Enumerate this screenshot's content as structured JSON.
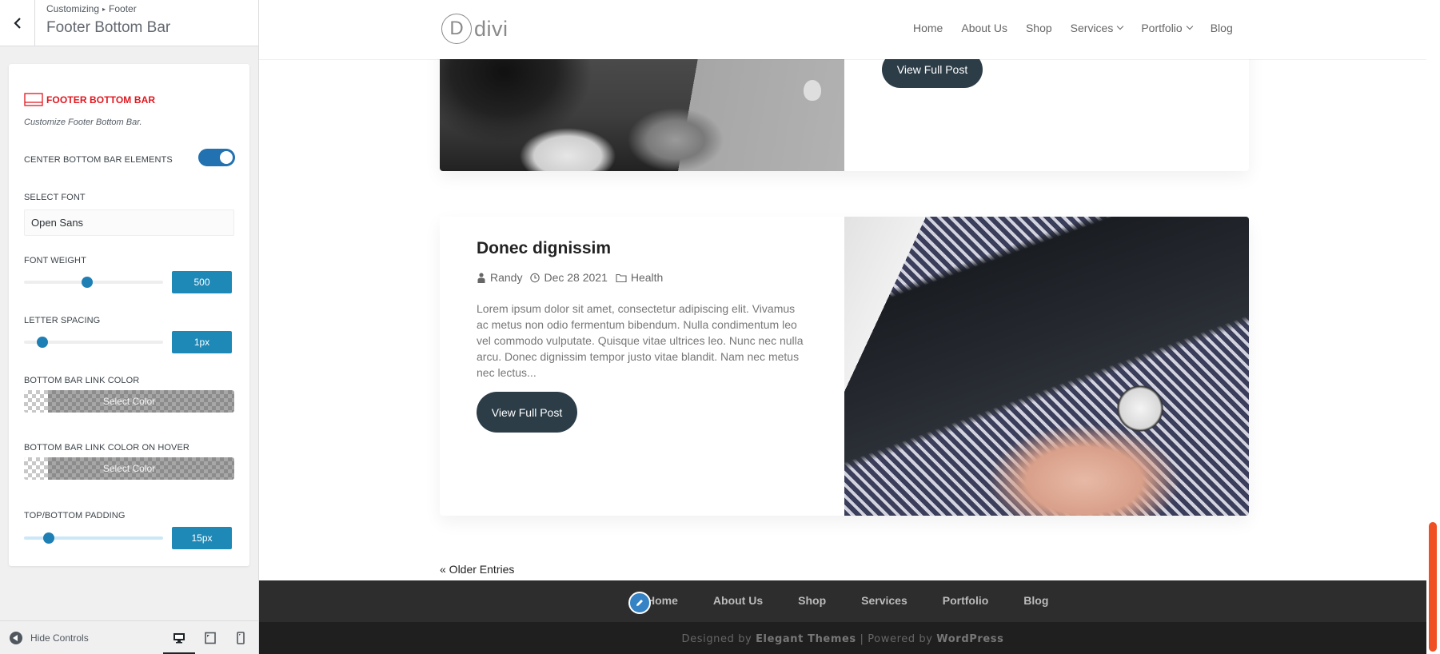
{
  "customizer": {
    "breadcrumb": {
      "root": "Customizing",
      "separator": "▸",
      "parent": "Footer"
    },
    "title": "Footer Bottom Bar",
    "section": {
      "title": "FOOTER BOTTOM BAR",
      "description": "Customize Footer Bottom Bar.",
      "accent_color": "#e0161e"
    },
    "controls": {
      "center_elements": {
        "label": "CENTER BOTTOM BAR ELEMENTS",
        "enabled": true
      },
      "select_font": {
        "label": "SELECT FONT",
        "value": "Open Sans"
      },
      "font_weight": {
        "label": "FONT WEIGHT",
        "value": "500",
        "slider_fraction": 0.45
      },
      "letter_spacing": {
        "label": "LETTER SPACING",
        "value": "1px",
        "slider_fraction": 0.1
      },
      "link_color": {
        "label": "BOTTOM BAR LINK COLOR",
        "button": "Select Color"
      },
      "link_color_hover": {
        "label": "BOTTOM BAR LINK COLOR ON HOVER",
        "button": "Select Color"
      },
      "padding": {
        "label": "TOP/BOTTOM PADDING",
        "value": "15px",
        "slider_fraction": 0.15
      }
    },
    "footer": {
      "hide_controls": "Hide Controls",
      "devices": [
        {
          "name": "desktop",
          "active": true
        },
        {
          "name": "tablet",
          "active": false
        },
        {
          "name": "mobile",
          "active": false
        }
      ]
    }
  },
  "site": {
    "logo_letter": "D",
    "logo_word": "divi",
    "nav": [
      {
        "label": "Home",
        "dropdown": false
      },
      {
        "label": "About Us",
        "dropdown": false
      },
      {
        "label": "Shop",
        "dropdown": false
      },
      {
        "label": "Services",
        "dropdown": true
      },
      {
        "label": "Portfolio",
        "dropdown": true
      },
      {
        "label": "Blog",
        "dropdown": false
      }
    ],
    "posts": [
      {
        "button": "View Full Post"
      },
      {
        "title": "Donec dignissim",
        "author": "Randy",
        "date": "Dec 28 2021",
        "category": "Health",
        "excerpt": "Lorem ipsum dolor sit amet, consectetur adipiscing elit. Vivamus ac metus non odio fermentum bibendum. Nulla condimentum leo vel commodo vulputate. Quisque vitae ultrices leo. Nunc nec nulla arcu. Donec dignissim tempor justo vitae blandit. Nam nec metus nec lectus...",
        "button": "View Full Post"
      }
    ],
    "older_entries": "« Older Entries",
    "footer_nav": [
      "Home",
      "About Us",
      "Shop",
      "Services",
      "Portfolio",
      "Blog"
    ],
    "credits": {
      "designed_by": "Designed by",
      "designer": "Elegant Themes",
      "separator": "|",
      "powered_by": "Powered by",
      "platform": "WordPress"
    },
    "scrollbar_color": "#f04e23"
  }
}
